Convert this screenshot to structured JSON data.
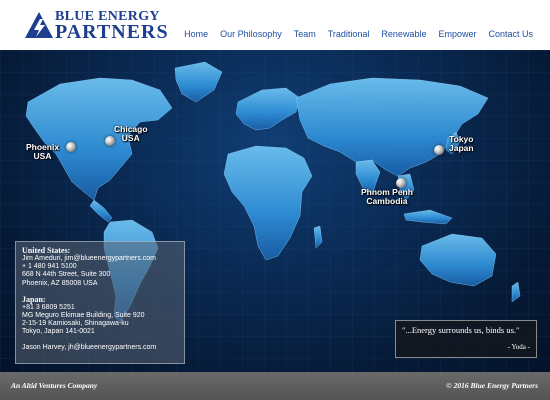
{
  "brand": {
    "line1": "BLUE ENERGY",
    "line2": "PARTNERS",
    "accent": "#1e3f8f"
  },
  "nav": {
    "items": [
      {
        "label": "Home"
      },
      {
        "label": "Our Philosophy"
      },
      {
        "label": "Team"
      },
      {
        "label": "Traditional"
      },
      {
        "label": "Renewable"
      },
      {
        "label": "Empower"
      },
      {
        "label": "Contact Us"
      }
    ],
    "color": "#1f4fa0"
  },
  "map": {
    "locations": [
      {
        "line1": "Phoenix",
        "line2": "USA"
      },
      {
        "line1": "Chicago",
        "line2": "USA"
      },
      {
        "line1": "Tokyo",
        "line2": "Japan"
      },
      {
        "line1": "Phnom Penh",
        "line2": "Cambodia"
      }
    ]
  },
  "contact": {
    "us_heading": "United States:",
    "us_lines": [
      "Jim Ameduri, jim@blueenergypartners.com",
      "+  1  480  941  5100",
      "668 N 44th Street, Suite 300",
      "Phoenix, AZ 85008 USA"
    ],
    "jp_heading": "Japan:",
    "jp_lines": [
      "+81  3  6809  5251",
      "MG Meguro Ekimae Building, Suite 920",
      "2-15-19 Kamiosaki, Shinagawa-ku",
      "Tokyo, Japan 141-0021"
    ],
    "extra": "Jason Harvey, jh@blueenergypartners.com"
  },
  "quote": {
    "text": "\"...Energy surrounds us, binds us.\"",
    "author": "- Yoda -"
  },
  "footer": {
    "left": "An Altid Ventures Company",
    "right": "© 2016 Blue Energy Partners"
  }
}
